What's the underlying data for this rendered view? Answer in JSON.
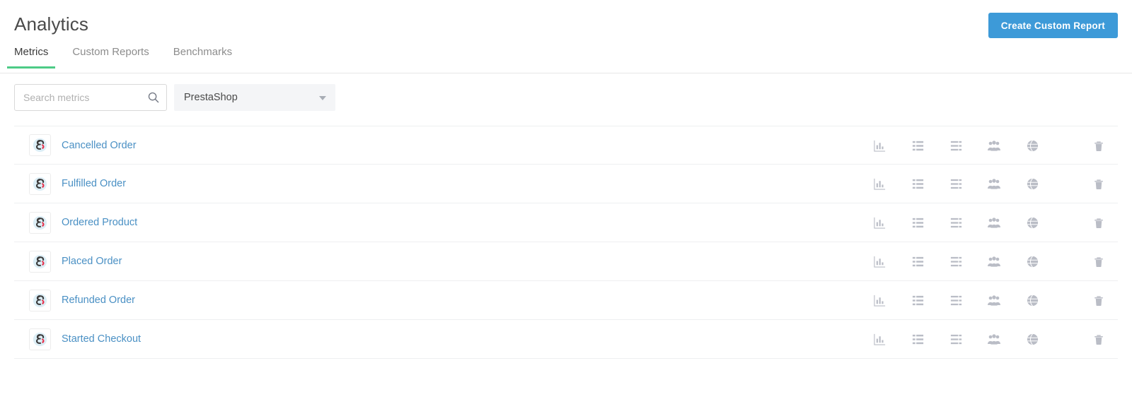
{
  "header": {
    "title": "Analytics",
    "create_report_label": "Create Custom Report"
  },
  "tabs": [
    {
      "label": "Metrics",
      "active": true
    },
    {
      "label": "Custom Reports",
      "active": false
    },
    {
      "label": "Benchmarks",
      "active": false
    }
  ],
  "filters": {
    "search_placeholder": "Search metrics",
    "search_value": "",
    "search_icon": "search-icon",
    "app_select_value": "PrestaShop",
    "app_select_caret_icon": "chevron-down-icon"
  },
  "metrics": [
    {
      "name": "Cancelled Order",
      "app_icon": "prestashop-logo-icon"
    },
    {
      "name": "Fulfilled Order",
      "app_icon": "prestashop-logo-icon"
    },
    {
      "name": "Ordered Product",
      "app_icon": "prestashop-logo-icon"
    },
    {
      "name": "Placed Order",
      "app_icon": "prestashop-logo-icon"
    },
    {
      "name": "Refunded Order",
      "app_icon": "prestashop-logo-icon"
    },
    {
      "name": "Started Checkout",
      "app_icon": "prestashop-logo-icon"
    }
  ],
  "row_actions": [
    {
      "icon": "bar-chart-icon",
      "name": "chart-action"
    },
    {
      "icon": "grid-table-icon",
      "name": "table-action"
    },
    {
      "icon": "list-rows-icon",
      "name": "list-action"
    },
    {
      "icon": "people-group-icon",
      "name": "cohort-action"
    },
    {
      "icon": "globe-icon",
      "name": "geography-action"
    },
    {
      "icon": "trash-icon",
      "name": "delete-action"
    }
  ],
  "colors": {
    "accent_blue": "#3d9ad8",
    "link_blue": "#4a90c4",
    "tab_underline_green": "#4dcb86",
    "row_border": "#eeeff1",
    "icon_gray": "#b7bac4",
    "select_background": "#f4f5f7"
  }
}
